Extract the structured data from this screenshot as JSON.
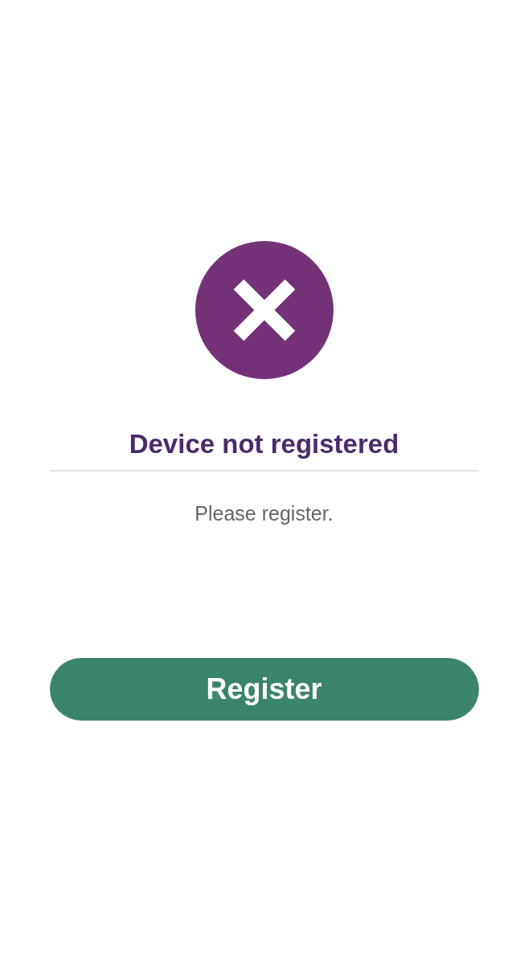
{
  "title": "Device not registered",
  "message": "Please register.",
  "button": {
    "label": "Register"
  }
}
